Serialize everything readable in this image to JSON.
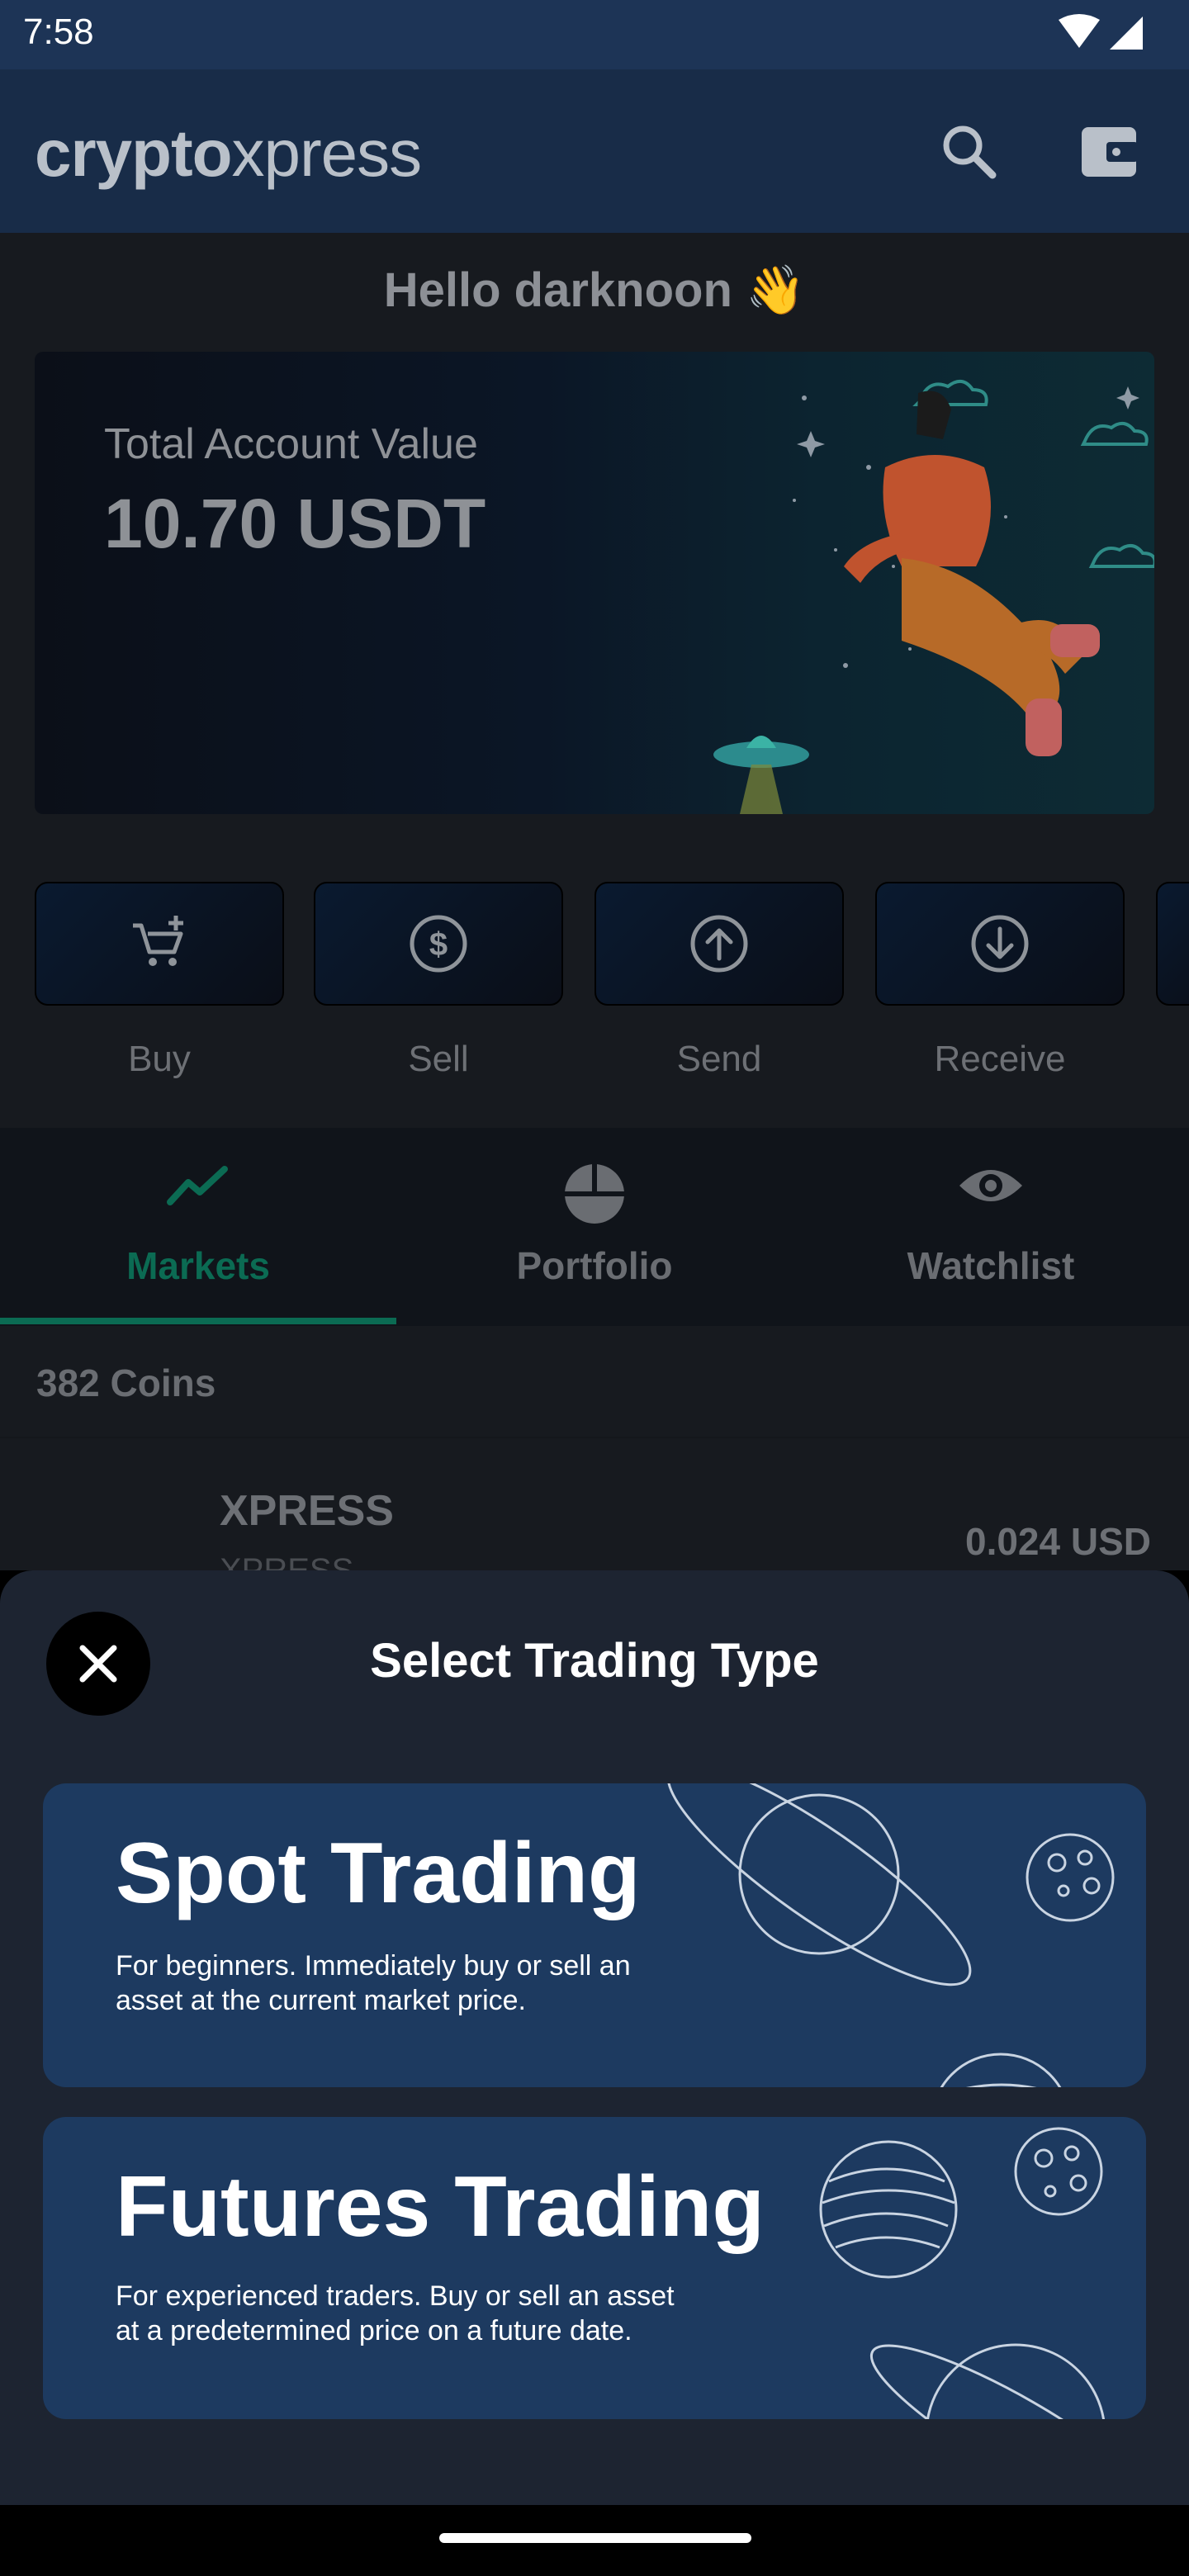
{
  "status_bar": {
    "time": "7:58"
  },
  "app_bar": {
    "logo_bold": "crypto",
    "logo_light": "xpress",
    "icons": [
      "search-icon",
      "wallet-icon"
    ]
  },
  "greeting": "Hello darknoon 👋",
  "account": {
    "label": "Total Account Value",
    "value": "10.70 USDT"
  },
  "quick_actions": [
    {
      "label": "Buy",
      "icon": "cart-plus-icon"
    },
    {
      "label": "Sell",
      "icon": "dollar-circle-icon"
    },
    {
      "label": "Send",
      "icon": "arrow-up-circle-icon"
    },
    {
      "label": "Receive",
      "icon": "arrow-down-circle-icon"
    }
  ],
  "tabs": [
    {
      "label": "Markets",
      "icon": "trend-icon",
      "active": true
    },
    {
      "label": "Portfolio",
      "icon": "pie-chart-icon",
      "active": false
    },
    {
      "label": "Watchlist",
      "icon": "eye-icon",
      "active": false
    }
  ],
  "coins_count": "382 Coins",
  "coin_row": {
    "name": "XPRESS",
    "symbol": "XPRESS",
    "price": "0.024 USD"
  },
  "sheet": {
    "title": "Select Trading Type",
    "options": [
      {
        "title": "Spot Trading",
        "desc_line1": "For beginners. Immediately buy or sell an",
        "desc_line2": "asset at the current market price."
      },
      {
        "title": "Futures Trading",
        "desc_line1": "For experienced traders. Buy or sell an asset",
        "desc_line2": "at a predetermined price on a future date."
      }
    ]
  },
  "colors": {
    "accent": "#0b6b53",
    "sheet_bg": "#1d2431",
    "card_bg": "#1d3a60",
    "app_bar": "#182c48"
  }
}
